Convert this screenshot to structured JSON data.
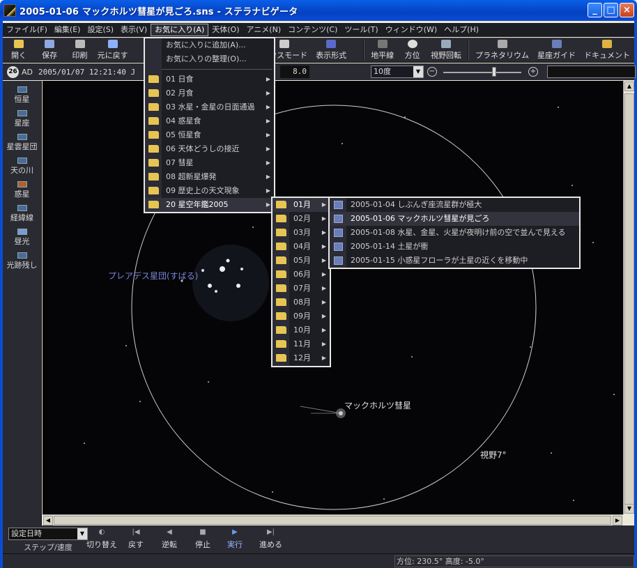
{
  "window": {
    "title": "2005-01-06 マックホルツ彗星が見ごろ.sns - ステラナビゲータ",
    "buttons": [
      "_",
      "□",
      "×"
    ]
  },
  "menubar": {
    "items": [
      "ファイル(F)",
      "編集(E)",
      "設定(S)",
      "表示(V)",
      "お気に入り(A)",
      "天体(O)",
      "アニメ(N)",
      "コンテンツ(C)",
      "ツール(T)",
      "ウィンドウ(W)",
      "ヘルプ(H)"
    ],
    "active": "お気に入り(A)"
  },
  "toolbar": {
    "buttons": [
      "開く",
      "保存",
      "印刷",
      "元に戻す",
      "マウスモード",
      "表示形式",
      "地平線",
      "方位",
      "視野回転",
      "プラネタリウム",
      "星座ガイド",
      "ドキュメント"
    ]
  },
  "toolbar2": {
    "badge": "26",
    "era": "AD",
    "datetime": "2005/01/07 12:21:40 J",
    "magnitude": "8.0",
    "fov": "10度"
  },
  "sidepanel": {
    "items": [
      "恒星",
      "星座",
      "星雲星団",
      "天の川",
      "惑星",
      "経緯線",
      "昼光",
      "光跡残し"
    ]
  },
  "sky": {
    "labels": {
      "pleiades": "プレアデス星団(すばる)",
      "comet": "マックホルツ彗星",
      "fov_label": "視野7°"
    }
  },
  "favorites_menu": {
    "top": [
      "お気に入りに追加(A)...",
      "お気に入りの整理(O)..."
    ],
    "folders": [
      "01 日食",
      "02 月食",
      "03 水星・金星の日面通過",
      "04 惑星食",
      "05 恒星食",
      "06 天体どうしの接近",
      "07 彗星",
      "08 超新星爆発",
      "09 歴史上の天文現象",
      "20 星空年鑑2005"
    ]
  },
  "months_menu": {
    "items": [
      "01月",
      "02月",
      "03月",
      "04月",
      "05月",
      "06月",
      "07月",
      "08月",
      "09月",
      "10月",
      "11月",
      "12月"
    ]
  },
  "events_menu": {
    "items": [
      "2005-01-04 しぶんぎ座流星群が極大",
      "2005-01-06 マックホルツ彗星が見ごろ",
      "2005-01-08 水星、金星、火星が夜明け前の空で並んで見える",
      "2005-01-14 土星が衝",
      "2005-01-15 小惑星フローラが土星の近くを移動中"
    ]
  },
  "bottombar": {
    "step_select": "設定日時",
    "step_label": "ステップ/速度",
    "buttons": [
      "切り替え",
      "戻す",
      "逆転",
      "停止",
      "実行",
      "進める"
    ]
  },
  "status": {
    "text": "方位: 230.5°  高度: -5.0°"
  },
  "colors": {
    "title_blue": "#0A5FE8",
    "dark_panel": "#2a2a32",
    "sky": "#050508",
    "folder": "#e7c553",
    "label_blue": "#7c86d8"
  }
}
